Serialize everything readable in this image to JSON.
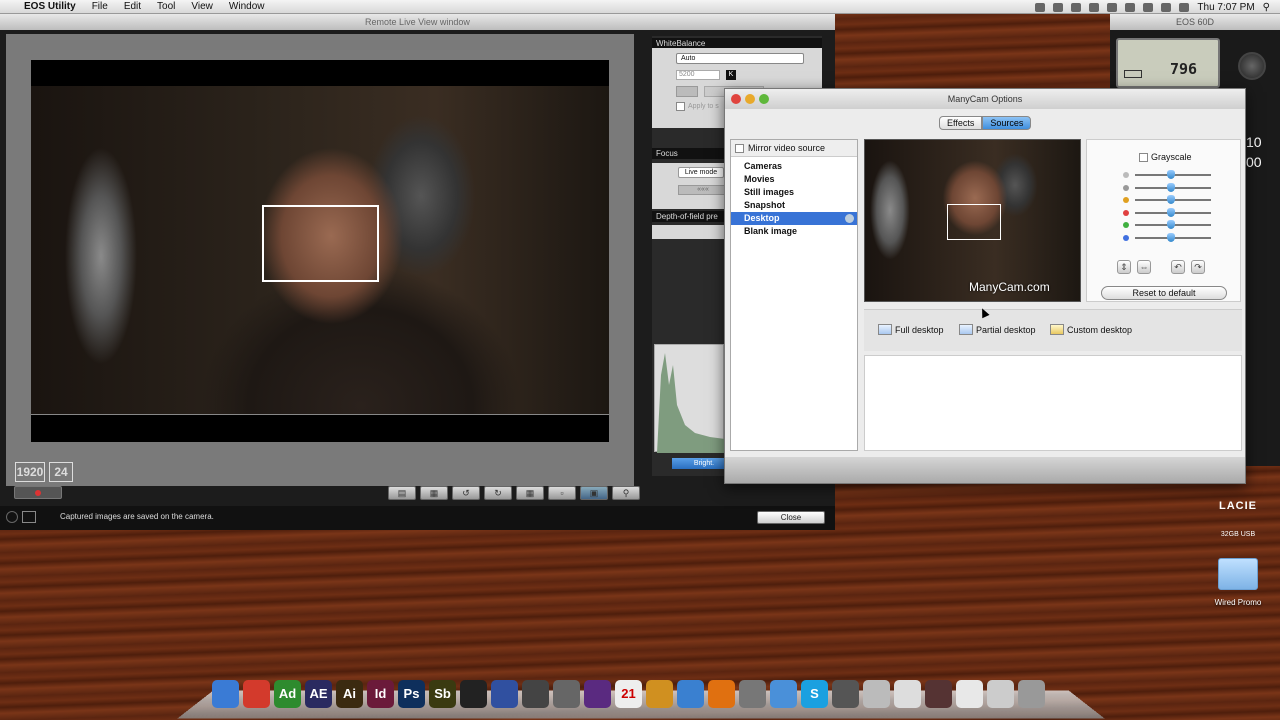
{
  "menubar": {
    "apple_glyph": "",
    "app": "EOS Utility",
    "items": [
      "File",
      "Edit",
      "Tool",
      "View",
      "Window"
    ],
    "clock": "Thu 7:07 PM"
  },
  "eos_window": {
    "title": "Remote Live View window",
    "badge_res": "1920",
    "badge_fps": "24",
    "status_text": "Captured images are saved on the camera.",
    "close_label": "Close"
  },
  "eos_panel": {
    "white_balance_header": "WhiteBalance",
    "wb_value": "Auto",
    "kelvin_value": "5200",
    "kelvin_badge": "K",
    "apply_label": "Apply to s",
    "focus_header": "Focus",
    "live_mode": "Live mode",
    "dof_header": "Depth-of-field pre",
    "bright_label": "Bright."
  },
  "manycam": {
    "title": "ManyCam Options",
    "tabs": [
      "Effects",
      "Sources"
    ],
    "active_tab": "Sources",
    "mirror_label": "Mirror video source",
    "sources": [
      "Cameras",
      "Movies",
      "Still images",
      "Snapshot",
      "Desktop",
      "Blank image"
    ],
    "selected_source": "Desktop",
    "watermark": "ManyCam.com",
    "grayscale_label": "Grayscale",
    "slider_colors": [
      "#bbbbbb",
      "#999999",
      "#e0a020",
      "#e04040",
      "#40b040",
      "#4070e0"
    ],
    "reset_label": "Reset to default",
    "desktop_options": [
      "Full desktop",
      "Partial desktop",
      "Custom desktop"
    ]
  },
  "eos60d": {
    "title": "EOS 60D",
    "shots_remaining": "796",
    "side_val1": "10",
    "side_val2": "00"
  },
  "desktop": {
    "drive_brand": "LACIE",
    "drive_label": "32GB USB",
    "folder_label": "Wired Promo"
  },
  "dock": {
    "apps": [
      {
        "icon": "finder-icon",
        "label": "",
        "color": "#3a7bd5"
      },
      {
        "icon": "chrome-icon",
        "label": "",
        "color": "#d33a2c"
      },
      {
        "icon": "audition-icon",
        "label": "Ad",
        "color": "#2e8b2e"
      },
      {
        "icon": "aftereffects-icon",
        "label": "AE",
        "color": "#2a2a60"
      },
      {
        "icon": "illustrator-icon",
        "label": "Ai",
        "color": "#3b2a10"
      },
      {
        "icon": "indesign-icon",
        "label": "Id",
        "color": "#6b1a3a"
      },
      {
        "icon": "photoshop-icon",
        "label": "Ps",
        "color": "#0e2f5c"
      },
      {
        "icon": "soundbooth-icon",
        "label": "Sb",
        "color": "#3a3a10"
      },
      {
        "icon": "camera-icon",
        "label": "",
        "color": "#222222"
      },
      {
        "icon": "screen-icon",
        "label": "",
        "color": "#3050a0"
      },
      {
        "icon": "clapper-icon",
        "label": "",
        "color": "#444444"
      },
      {
        "icon": "pen-icon",
        "label": "",
        "color": "#666666"
      },
      {
        "icon": "headphones-icon",
        "label": "",
        "color": "#5a2a80"
      },
      {
        "icon": "calendar-icon",
        "label": "21",
        "color": "#eeeeee"
      },
      {
        "icon": "plugin-icon",
        "label": "",
        "color": "#d09020"
      },
      {
        "icon": "itunes-icon",
        "label": "",
        "color": "#3a80d0"
      },
      {
        "icon": "vlc-icon",
        "label": "",
        "color": "#e07010"
      },
      {
        "icon": "network-icon",
        "label": "",
        "color": "#777777"
      },
      {
        "icon": "safari-icon",
        "label": "",
        "color": "#4a90d9"
      },
      {
        "icon": "skype-icon",
        "label": "S",
        "color": "#1aa0e0"
      },
      {
        "icon": "photobooth-icon",
        "label": "",
        "color": "#555555"
      },
      {
        "icon": "stopwatch-icon",
        "label": "",
        "color": "#bbbbbb"
      },
      {
        "icon": "tray-icon",
        "label": "",
        "color": "#dddddd"
      },
      {
        "icon": "image-icon",
        "label": "",
        "color": "#553333"
      },
      {
        "icon": "document-icon",
        "label": "",
        "color": "#e8e8e8"
      },
      {
        "icon": "preview-icon",
        "label": "",
        "color": "#cccccc"
      },
      {
        "icon": "trash-icon",
        "label": "",
        "color": "#999999"
      }
    ]
  }
}
